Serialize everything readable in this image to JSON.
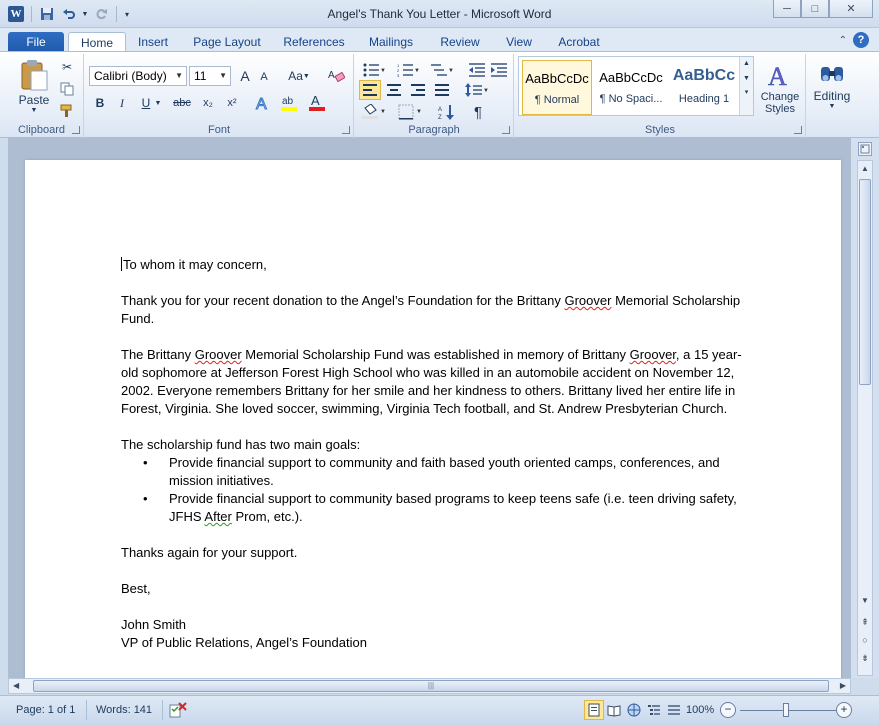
{
  "window": {
    "title": "Angel's Thank You Letter  -  Microsoft Word",
    "minimize": "─",
    "maximize": "□",
    "close": "✕"
  },
  "tabs": [
    "File",
    "Home",
    "Insert",
    "Page Layout",
    "References",
    "Mailings",
    "Review",
    "View",
    "Acrobat"
  ],
  "ribbon": {
    "clipboard": {
      "paste": "Paste",
      "label": "Clipboard"
    },
    "font": {
      "family": "Calibri (Body)",
      "size": "11",
      "label": "Font",
      "bold": "B",
      "italic": "I",
      "underline": "U",
      "strike": "abc",
      "sub": "x₂",
      "sup": "x²",
      "case": "Aa",
      "grow": "A",
      "shrink": "A"
    },
    "paragraph": {
      "label": "Paragraph",
      "pilcrow": "¶"
    },
    "styles": {
      "label": "Styles",
      "items": [
        {
          "sample": "AaBbCcDc",
          "name": "¶ Normal"
        },
        {
          "sample": "AaBbCcDc",
          "name": "¶ No Spaci..."
        },
        {
          "sample": "AaBbCc",
          "name": "Heading 1"
        }
      ],
      "change_styles": "Change Styles"
    },
    "editing": {
      "label": "Editing"
    }
  },
  "document": {
    "greeting": "To whom it may concern,",
    "p1": {
      "a": "Thank you for your recent donation to the Angel’s Foundation for the Brittany ",
      "b": "Groover",
      "c": " Memorial Scholarship Fund."
    },
    "p2": {
      "a": "The Brittany ",
      "b": "Groover",
      "c": " Memorial Scholarship Fund was established in memory of Brittany ",
      "d": "Groover",
      "e": ", a 15 year-old sophomore at Jefferson Forest High School who was killed in an automobile accident on November 12, 2002.   Everyone remembers Brittany for her smile and her kindness to others.  Brittany lived her entire life in Forest, Virginia.  She loved soccer, swimming, Virginia Tech football, and St. Andrew Presbyterian Church."
    },
    "goals_intro": "The scholarship fund has two main goals:",
    "goal1": "Provide financial support to community and faith based youth oriented camps, conferences, and mission initiatives.",
    "goal2": {
      "a": "Provide financial support to community based programs to keep teens safe (i.e. teen driving safety, JFHS ",
      "b": "After",
      "c": " Prom, etc.)."
    },
    "thanks": "Thanks again for your support.",
    "closing": "Best,",
    "signer_name": "John Smith",
    "signer_title": "VP of Public Relations, Angel’s Foundation"
  },
  "status": {
    "page": "Page: 1 of 1",
    "words": "Words: 141",
    "zoom": "100%",
    "zoom_minus": "−",
    "zoom_plus": "+"
  }
}
